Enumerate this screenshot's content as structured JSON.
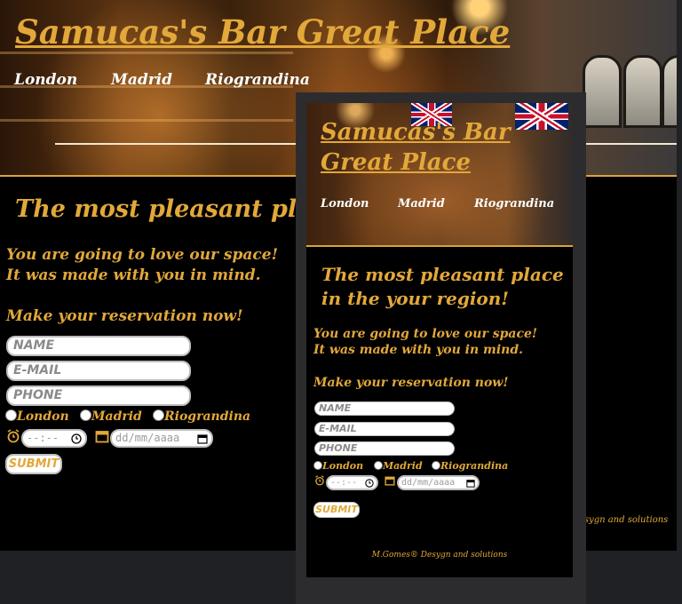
{
  "site": {
    "title": "Samucas's Bar Great Place",
    "nav": [
      "London",
      "Madrid",
      "Riograndina"
    ],
    "headline": "The most pleasant place in the your region!",
    "headline_desktop_visible": "The most pleasant place in",
    "intro_line1": "You are going to love our space!",
    "intro_line2": "It was made with you in mind.",
    "reservation": "Make your reservation now!",
    "form": {
      "name_placeholder": "NAME",
      "email_placeholder": "E-MAIL",
      "phone_placeholder": "PHONE",
      "radio_options": [
        "London",
        "Madrid",
        "Riograndina"
      ],
      "time_placeholder": "--:--",
      "date_placeholder": "dd/mm/aaaa",
      "submit_label": "SUBMIT"
    },
    "footer": "M.Gomes® Desygn and solutions",
    "footer_desktop_visible": "esygn and solutions"
  },
  "colors": {
    "accent": "#e2a83a",
    "background": "#000000",
    "frame": "#2c2c2e"
  },
  "icons": {
    "alarm": "alarm-clock-icon",
    "calendar": "calendar-icon",
    "clock": "clock-icon"
  }
}
